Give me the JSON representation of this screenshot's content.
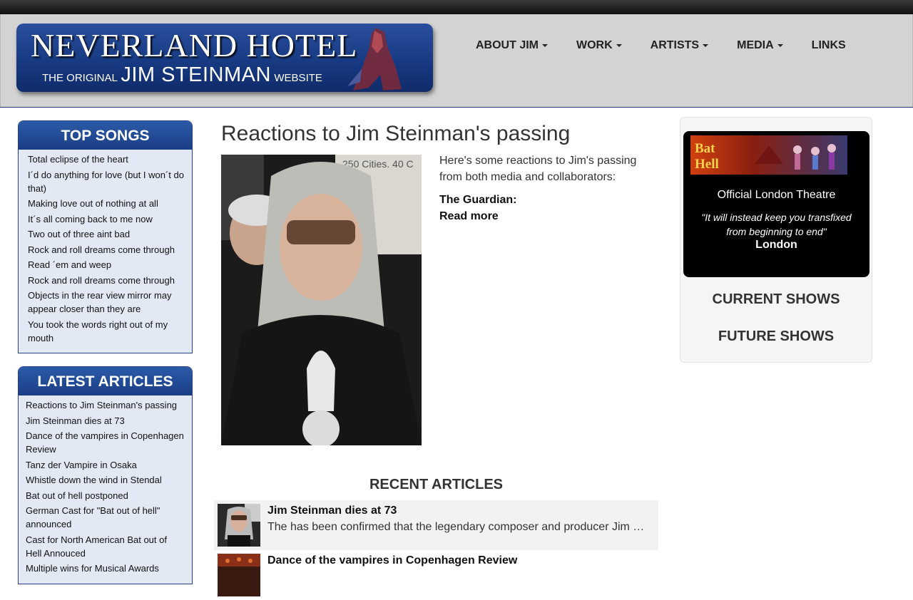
{
  "header": {
    "logo": {
      "title": "NEVERLAND HOTEL",
      "subtitle_small_1": "THE ORIGINAL",
      "subtitle_big": "JIM STEINMAN",
      "subtitle_small_2": "WEBSITE"
    },
    "nav": [
      {
        "label": "ABOUT JIM",
        "dropdown": true
      },
      {
        "label": "WORK",
        "dropdown": true
      },
      {
        "label": "ARTISTS",
        "dropdown": true
      },
      {
        "label": "MEDIA",
        "dropdown": true
      },
      {
        "label": "LINKS",
        "dropdown": false
      }
    ]
  },
  "sidebar": {
    "top_songs": {
      "title": "TOP SONGS",
      "items": [
        "Total eclipse of the heart",
        "I´d do anything for love (but I won´t do that)",
        "Making love out of nothing at all",
        "It´s all coming back to me now",
        "Two out of three aint bad",
        "Rock and roll dreams come through",
        "Read ´em and weep",
        "Rock and roll dreams come through",
        "Objects in the rear view mirror may appear closer than they are",
        "You took the words right out of my mouth"
      ]
    },
    "latest_articles": {
      "title": "LATEST ARTICLES",
      "items": [
        "Reactions to Jim Steinman's passing",
        "Jim Steinman dies at 73",
        "Dance of the vampires in Copenhagen Review",
        "Tanz der Vampire in Osaka",
        "Whistle down the wind in Stendal",
        "Bat out of hell postponed",
        "German Cast for \"Bat out of hell\" announced",
        "Cast for North American Bat out of Hell Annouced",
        "Multiple wins for Musical Awards"
      ]
    }
  },
  "main": {
    "title": "Reactions to Jim Steinman's passing",
    "intro": "Here's some reactions to Jim's passing from both media and collaborators:",
    "source": "The Guardian:",
    "read_more": "Read more",
    "recent_title": "RECENT ARTICLES",
    "recent": [
      {
        "title": "Jim Steinman dies at 73",
        "excerpt": "The has been confirmed that the legendary composer and producer Jim Steinman has died"
      },
      {
        "title": "Dance of the vampires in Copenhagen Review",
        "excerpt": ""
      }
    ]
  },
  "aside": {
    "show": {
      "name": "Official London Theatre",
      "quote": "\"It will instead keep you transfixed from beginning to end\"",
      "city": "London",
      "banner_text": "Bat out of Hell"
    },
    "current_shows": "CURRENT SHOWS",
    "future_shows": "FUTURE SHOWS"
  },
  "colors": {
    "panel_blue": "#1a3e85",
    "panel_bg": "#e3e9f4",
    "header_bg": "#d3d3d3"
  }
}
